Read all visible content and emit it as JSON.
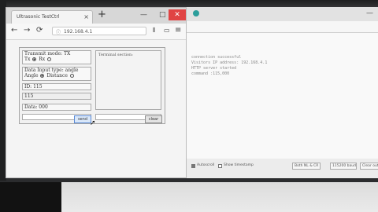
{
  "browser": {
    "tab_title": "Ultrasonic TestCtrl",
    "tab_close": "×",
    "new_tab": "+",
    "minimize": "—",
    "maximize": "□",
    "close": "✕",
    "back": "←",
    "forward": "→",
    "reload": "⟳",
    "url": "192.168.4.1",
    "bookmarks": "⫴",
    "tabs_icon": "▭",
    "menu": "≡"
  },
  "app": {
    "transmit_mode_label": "Transmit mode: TX",
    "tx_option": "Tx",
    "rx_option": "Rx",
    "data_input_label": "Data Input type: angle",
    "angle_option": "Angle",
    "distance_option": "Distance",
    "id_label": "ID: 115",
    "id_value": "115",
    "data_label": "Data: 000",
    "terminal_title": "Terminal section:",
    "send_button": "send",
    "clear_button": "clear",
    "input_value": ""
  },
  "monitor": {
    "lines": [
      "connection successful",
      "Visitors IP address: 192.168.4.1",
      "HTTP server started",
      "command :115,000"
    ],
    "autoscroll_label": "Autoscroll",
    "timestamp_label": "Show timestamp",
    "line_ending": "Both NL & CR",
    "baud": "115200 baud",
    "clear_output": "Clear output"
  }
}
